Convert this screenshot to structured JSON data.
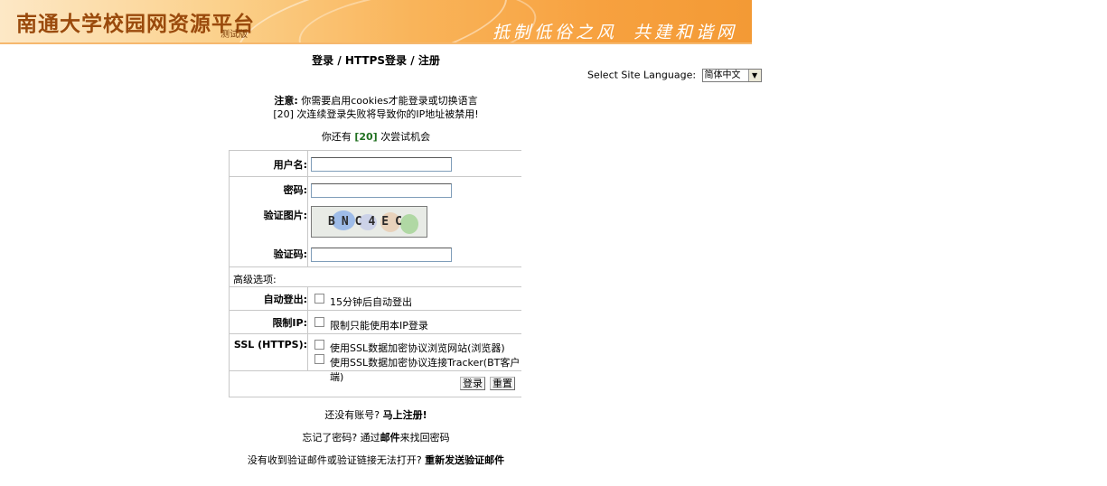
{
  "banner": {
    "title": "南通大学校园网资源平台",
    "edition": "测试版",
    "slogan_left": "抵制低俗之风",
    "slogan_right": "共建和谐网络"
  },
  "nav": {
    "login": "登录",
    "sep1": " / ",
    "https_login": "HTTPS登录",
    "sep2": " / ",
    "register": "注册"
  },
  "language": {
    "label": "Select Site Language:",
    "selected": "简体中文"
  },
  "notice": {
    "prefix": "注意:",
    "line1": "你需要启用cookies才能登录或切换语言",
    "line2": "[20] 次连续登录失败将导致你的IP地址被禁用!",
    "attempts_prefix": "你还有",
    "attempts": "[20]",
    "attempts_suffix": "次尝试机会"
  },
  "form": {
    "username_label": "用户名:",
    "password_label": "密码:",
    "captcha_image_label": "验证图片:",
    "captcha_text": "BNC4EC",
    "captcha_code_label": "验证码:",
    "advanced_label": "高级选项:",
    "auto_logout_label": "自动登出:",
    "auto_logout_option": "15分钟后自动登出",
    "limit_ip_label": "限制IP:",
    "limit_ip_option": "限制只能使用本IP登录",
    "ssl_label": "SSL (HTTPS):",
    "ssl_option1": "使用SSL数据加密协议浏览网站(浏览器)",
    "ssl_option2": "使用SSL数据加密协议连接Tracker(BT客户端)",
    "login_button": "登录",
    "reset_button": "重置"
  },
  "footer": {
    "no_account": "还没有账号?",
    "register_now": "马上注册!",
    "forgot_password": "忘记了密码?",
    "recover_prefix": "通过",
    "recover_link": "邮件",
    "recover_suffix": "来找回密码",
    "no_email": "没有收到验证邮件或验证链接无法打开?",
    "resend_email": "重新发送验证邮件"
  }
}
